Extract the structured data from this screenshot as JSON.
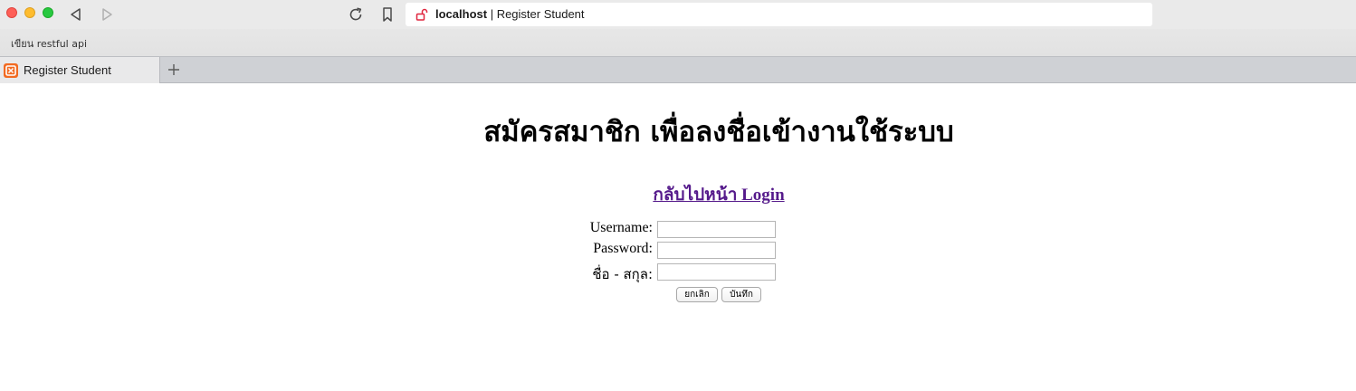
{
  "browser": {
    "address": {
      "host": "localhost",
      "separator": " | ",
      "page_title": "Register Student"
    },
    "bookmarks": [
      {
        "label": "เขียน restful api"
      }
    ],
    "tabs": [
      {
        "title": "Register Student"
      }
    ],
    "colors": {
      "favicon": "#f26a21",
      "insecure_lock": "#e0263f",
      "link_visited": "#551a8b"
    },
    "icons": {
      "close": "traffic-light-close",
      "minimize": "traffic-light-minimize",
      "zoom": "traffic-light-zoom",
      "back": "triangle-left",
      "forward": "triangle-right",
      "reload": "circular-arrow",
      "bookmark": "bookmark-ribbon",
      "lock": "open-padlock",
      "new_tab": "plus"
    }
  },
  "page": {
    "title": "สมัครสมาชิก เพื่อลงชื่อเข้างานใช้ระบบ",
    "back_link": "กลับไปหน้า Login",
    "form": {
      "username_label": "Username:",
      "password_label": "Password:",
      "fullname_label": "ชื่อ - สกุล:",
      "username_value": "",
      "password_value": "",
      "fullname_value": "",
      "cancel_label": "ยกเลิก",
      "save_label": "บันทึก"
    }
  }
}
